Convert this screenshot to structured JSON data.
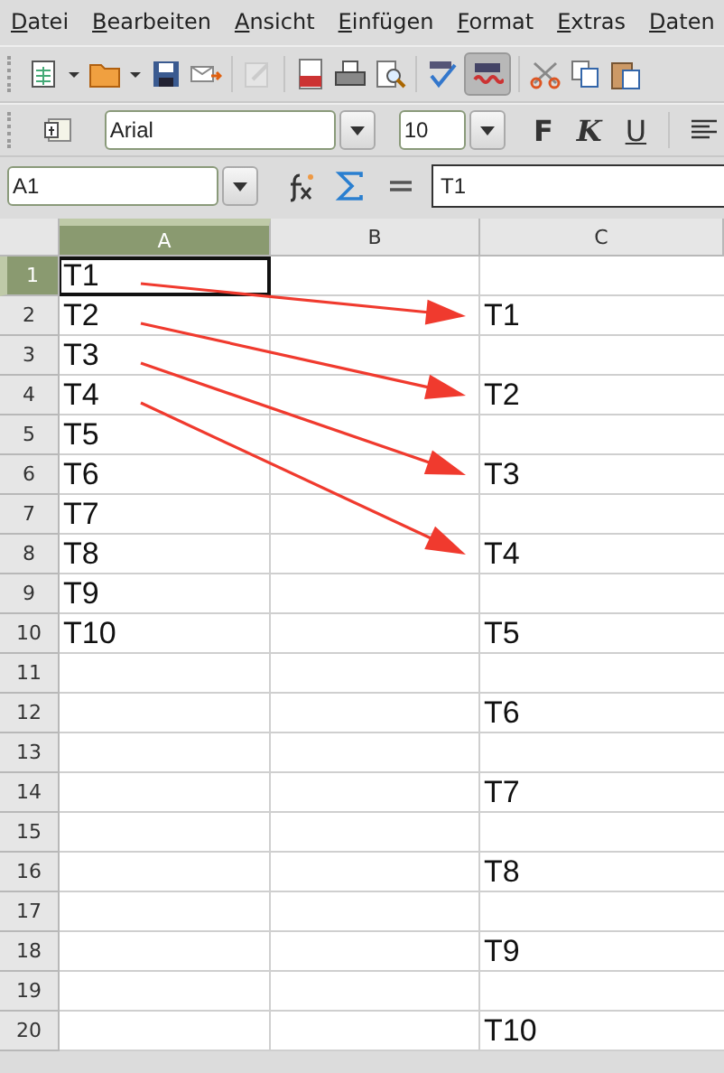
{
  "menu": [
    "Datei",
    "Bearbeiten",
    "Ansicht",
    "Einfügen",
    "Format",
    "Extras",
    "Daten"
  ],
  "toolbar": {
    "autospell_on": true
  },
  "format_bar": {
    "font": "Arial",
    "size": "10",
    "bold": "F",
    "italic": "K",
    "underline": "U"
  },
  "formula_bar": {
    "name_box": "A1",
    "formula": "T1"
  },
  "columns": [
    {
      "label": "A",
      "selected": true
    },
    {
      "label": "B",
      "selected": false
    },
    {
      "label": "C",
      "selected": false
    }
  ],
  "rows": [
    {
      "number": "1",
      "selected": true,
      "a": "T1",
      "arrow": true
    },
    {
      "number": "2",
      "selected": false,
      "a": "T2",
      "c": "T1",
      "arrow": true
    },
    {
      "number": "3",
      "selected": false,
      "a": "T3",
      "arrow": true
    },
    {
      "number": "4",
      "selected": false,
      "a": "T4",
      "c": "T2",
      "arrow": true
    },
    {
      "number": "5",
      "selected": false,
      "a": "T5"
    },
    {
      "number": "6",
      "selected": false,
      "a": "T6",
      "c": "T3"
    },
    {
      "number": "7",
      "selected": false,
      "a": "T7"
    },
    {
      "number": "8",
      "selected": false,
      "a": "T8",
      "c": "T4"
    },
    {
      "number": "9",
      "selected": false,
      "a": "T9"
    },
    {
      "number": "10",
      "selected": false,
      "a": "T10",
      "c": "T5"
    },
    {
      "number": "11",
      "selected": false
    },
    {
      "number": "12",
      "selected": false,
      "c": "T6"
    },
    {
      "number": "13",
      "selected": false
    },
    {
      "number": "14",
      "selected": false,
      "c": "T7"
    },
    {
      "number": "15",
      "selected": false
    },
    {
      "number": "16",
      "selected": false,
      "c": "T8"
    },
    {
      "number": "17",
      "selected": false
    },
    {
      "number": "18",
      "selected": false,
      "c": "T9"
    },
    {
      "number": "19",
      "selected": false
    },
    {
      "number": "20",
      "selected": false,
      "c": "T10"
    }
  ]
}
